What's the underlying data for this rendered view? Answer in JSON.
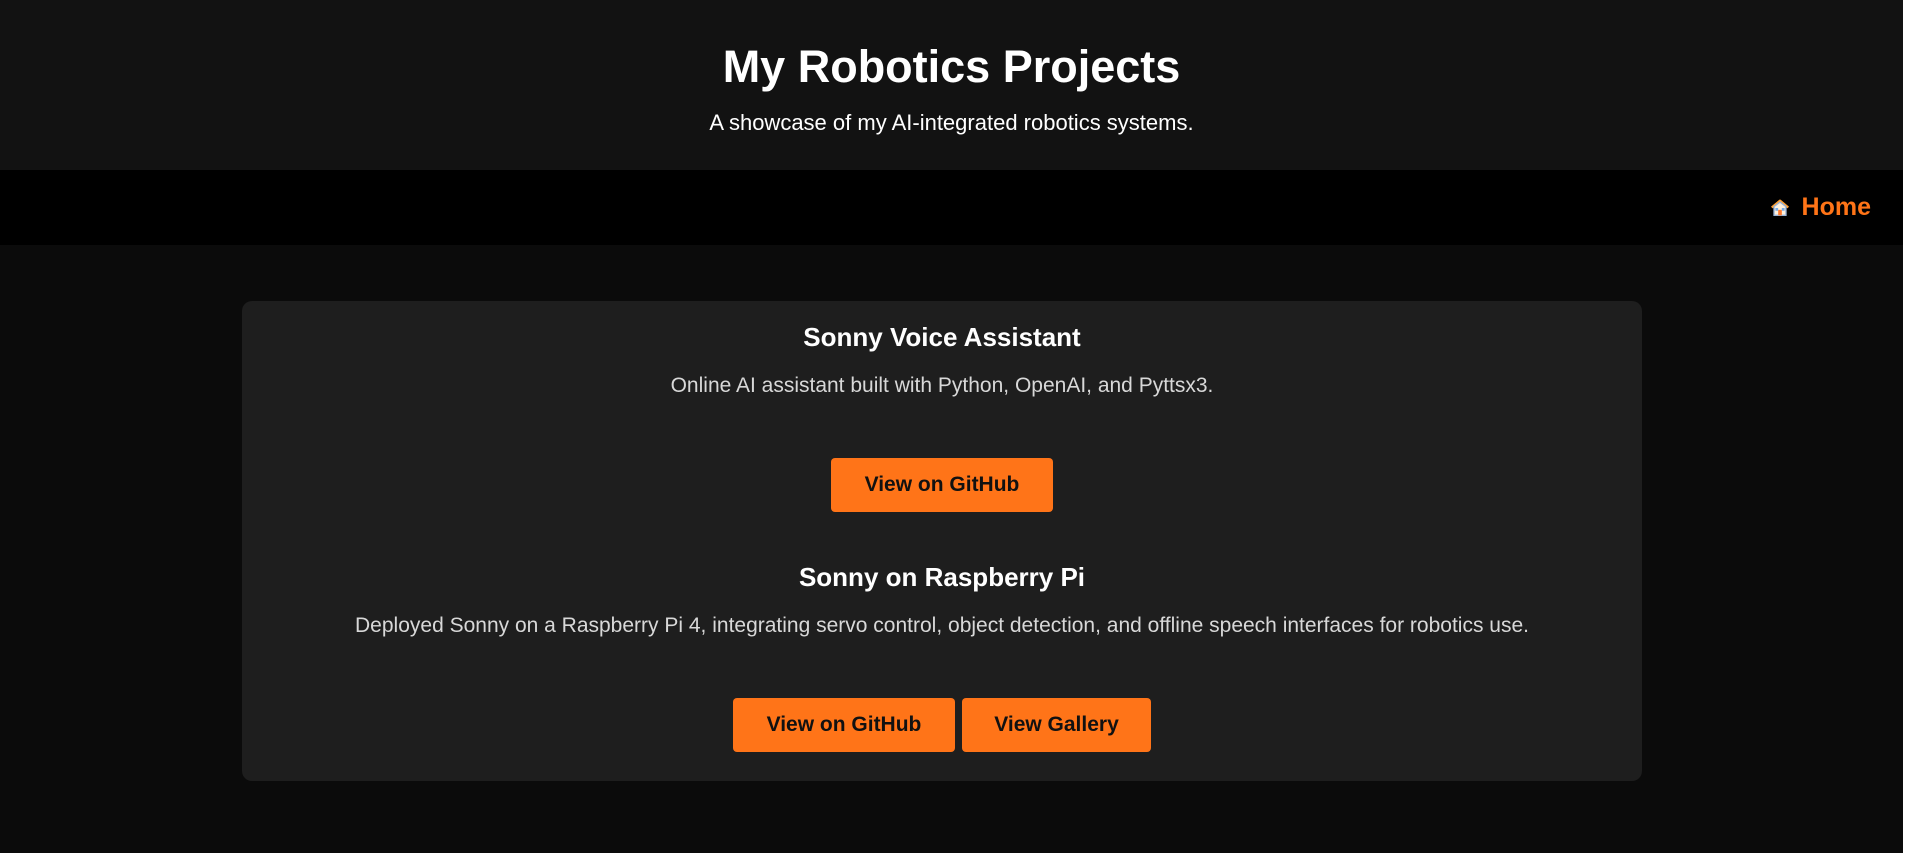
{
  "header": {
    "title": "My Robotics Projects",
    "subtitle": "A showcase of my AI-integrated robotics systems."
  },
  "nav": {
    "home_icon": "house-icon",
    "home_label": "Home",
    "accent_color": "#ff7417"
  },
  "projects": [
    {
      "title": "Sonny Voice Assistant",
      "description": "Online AI assistant built with Python, OpenAI, and Pyttsx3.",
      "buttons": [
        {
          "label": "View on GitHub"
        }
      ]
    },
    {
      "title": "Sonny on Raspberry Pi",
      "description": "Deployed Sonny on a Raspberry Pi 4, integrating servo control, object detection, and offline speech interfaces for robotics use.",
      "buttons": [
        {
          "label": "View on GitHub"
        },
        {
          "label": "View Gallery"
        }
      ]
    }
  ],
  "colors": {
    "header_background": "#121212",
    "nav_background": "#000000",
    "page_background": "#0b0b0b",
    "card_background": "#1e1e1e",
    "button_background": "#ff7418",
    "button_text": "#111111",
    "description_text": "#d8d8d8"
  }
}
